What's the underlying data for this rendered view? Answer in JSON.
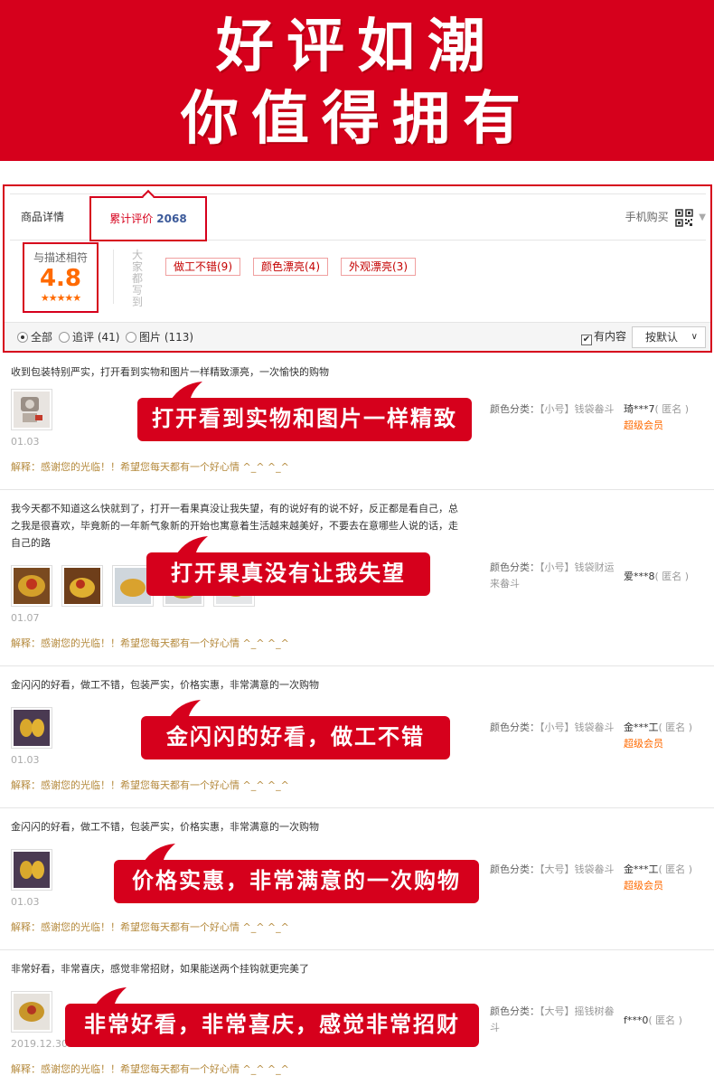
{
  "banner": {
    "line1": "好评如潮",
    "line2": "你值得拥有"
  },
  "tabs": {
    "detail": "商品详情",
    "reviews_label": "累计评价",
    "reviews_count": "2068",
    "mobile_buy": "手机购买"
  },
  "score": {
    "title": "与描述相符",
    "value": "4.8",
    "stars": "★★★★★",
    "star_rating": 5
  },
  "vertical_label": "大家都写到",
  "tags": [
    "做工不错(9)",
    "颜色漂亮(4)",
    "外观漂亮(3)"
  ],
  "filter": {
    "all": "全部",
    "followup": "追评 (41)",
    "pictures": "图片 (113)",
    "has_content": "有内容",
    "sort": "按默认"
  },
  "colors": {
    "accent": "#d6001c",
    "score": "#ff6a00",
    "reply": "#b58a3d"
  },
  "reviews": [
    {
      "text": "收到包装特别严实，打开看到实物和图片一样精致漂亮，一次愉快的购物",
      "date": "01.03",
      "reply": "解释：感谢您的光临！！希望您每天都有一个好心情 ^_^ ^_^",
      "sku_key": "颜色分类：",
      "sku_val": "【小号】钱袋畚斗",
      "user": "琦***7",
      "anon": "( 匿名 )",
      "vip": "超级会员",
      "bubble": "打开看到实物和图片一样精致"
    },
    {
      "text": "我今天都不知道这么快就到了，打开一看果真没让我失望，有的说好有的说不好，反正都是看自己，总之我是很喜欢，毕竟新的一年新气象新的开始也寓意着生活越来越美好，不要去在意哪些人说的话，走自己的路",
      "date": "01.07",
      "reply": "解释：感谢您的光临！！希望您每天都有一个好心情 ^_^ ^_^",
      "sku_key": "颜色分类：",
      "sku_val": "【小号】钱袋财运来畚斗",
      "user": "爱***8",
      "anon": "( 匿名 )",
      "vip": "",
      "bubble": "打开果真没有让我失望"
    },
    {
      "text": "金闪闪的好看，做工不错，包装严实，价格实惠，非常满意的一次购物",
      "date": "01.03",
      "reply": "解释：感谢您的光临！！希望您每天都有一个好心情 ^_^ ^_^",
      "sku_key": "颜色分类：",
      "sku_val": "【小号】钱袋畚斗",
      "user": "金***工",
      "anon": "( 匿名 )",
      "vip": "超级会员",
      "bubble": "金闪闪的好看，做工不错"
    },
    {
      "text": "金闪闪的好看，做工不错，包装严实，价格实惠，非常满意的一次购物",
      "date": "01.03",
      "reply": "解释：感谢您的光临！！希望您每天都有一个好心情 ^_^ ^_^",
      "sku_key": "颜色分类：",
      "sku_val": "【大号】钱袋畚斗",
      "user": "金***工",
      "anon": "( 匿名 )",
      "vip": "超级会员",
      "bubble": "价格实惠，非常满意的一次购物"
    },
    {
      "text": "非常好看，非常喜庆，感觉非常招财，如果能送两个挂钩就更完美了",
      "date": "2019.12.30",
      "reply": "解释：感谢您的光临！！希望您每天都有一个好心情 ^_^ ^_^",
      "sku_key": "颜色分类：",
      "sku_val": "【大号】摇钱树畚斗",
      "user": "f***0",
      "anon": "( 匿名 )",
      "vip": "",
      "bubble": "非常好看，非常喜庆，感觉非常招财"
    }
  ]
}
